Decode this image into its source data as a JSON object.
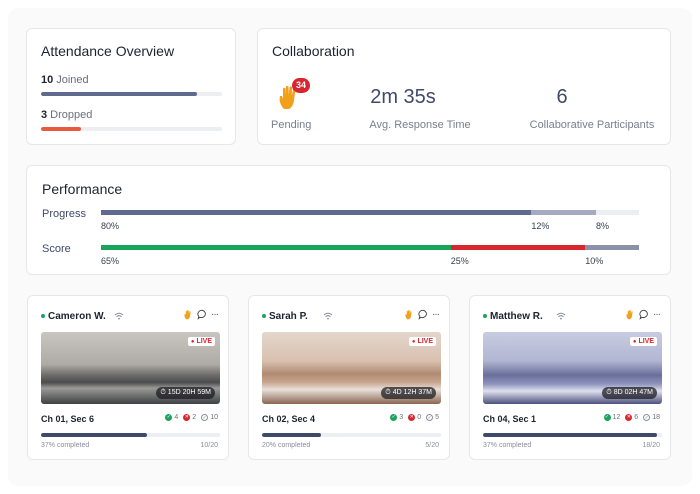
{
  "attendance": {
    "title": "Attendance Overview",
    "joined": {
      "count": "10",
      "label": "Joined",
      "fraction": 0.86,
      "color": "#5f6b8e"
    },
    "dropped": {
      "count": "3",
      "label": "Dropped",
      "fraction": 0.22,
      "color": "#e85a3c"
    }
  },
  "collaboration": {
    "title": "Collaboration",
    "pending": {
      "badge": "34",
      "label": "Pending",
      "icon": "raised-hand-icon"
    },
    "response": {
      "value": "2m 35s",
      "label": "Avg. Response Time"
    },
    "participants": {
      "value": "6",
      "label": "Collaborative Participants"
    }
  },
  "performance": {
    "title": "Performance",
    "progress": {
      "label": "Progress",
      "segments": [
        {
          "pct": "80%",
          "value": 0.8,
          "color": "#5f6b8e"
        },
        {
          "pct": "12%",
          "value": 0.12,
          "color": "#a5aac0"
        },
        {
          "pct": "8%",
          "value": 0.08,
          "color": "#eceef2"
        }
      ]
    },
    "score": {
      "label": "Score",
      "segments": [
        {
          "pct": "65%",
          "value": 0.65,
          "color": "#1aa35a"
        },
        {
          "pct": "25%",
          "value": 0.25,
          "color": "#d7262e"
        },
        {
          "pct": "10%",
          "value": 0.1,
          "color": "#8a91a8"
        }
      ]
    }
  },
  "sessions": [
    {
      "name": "Cameron W.",
      "live": "LIVE",
      "timer": "15D 20H 59M",
      "section": "Ch 01, Sec 6",
      "correct": "4",
      "wrong": "2",
      "done": "10",
      "completed": "37% completed",
      "fraction": 0.59,
      "ratio": "10/20"
    },
    {
      "name": "Sarah P.",
      "live": "LIVE",
      "timer": "4D 12H 37M",
      "section": "Ch 02, Sec 4",
      "correct": "3",
      "wrong": "0",
      "done": "5",
      "completed": "20% completed",
      "fraction": 0.33,
      "ratio": "5/20"
    },
    {
      "name": "Matthew R.",
      "live": "LIVE",
      "timer": "8D 02H 47M",
      "section": "Ch 04, Sec 1",
      "correct": "12",
      "wrong": "6",
      "done": "18",
      "completed": "37% completed",
      "fraction": 0.97,
      "ratio": "18/20"
    }
  ]
}
